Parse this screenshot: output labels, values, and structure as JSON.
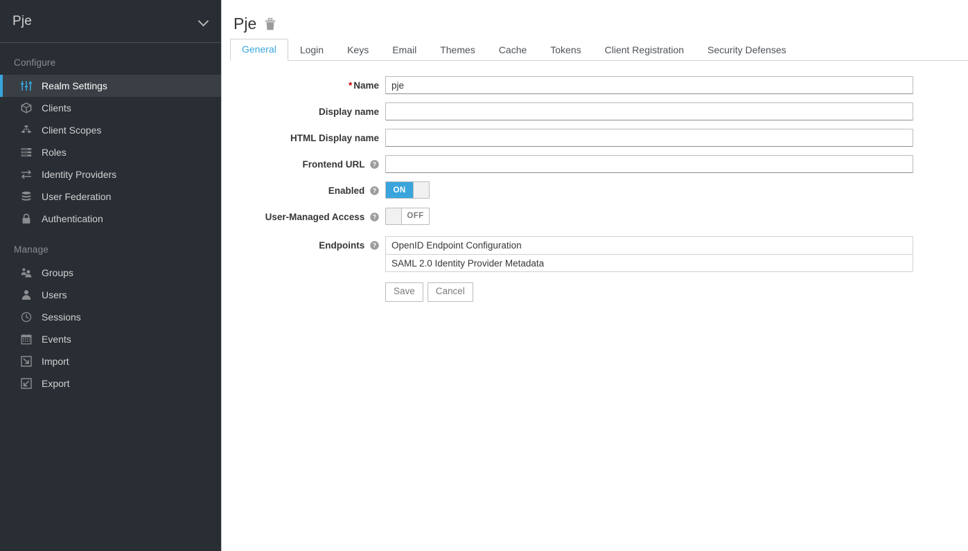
{
  "sidebar": {
    "realm": {
      "name": "Pje",
      "chevron_icon": "chevron-down-icon"
    },
    "groups": [
      {
        "title": "Configure",
        "items": [
          {
            "label": "Realm Settings",
            "icon": "sliders-icon",
            "active": true
          },
          {
            "label": "Clients",
            "icon": "cube-icon",
            "active": false
          },
          {
            "label": "Client Scopes",
            "icon": "cubes-icon",
            "active": false
          },
          {
            "label": "Roles",
            "icon": "list-icon",
            "active": false
          },
          {
            "label": "Identity Providers",
            "icon": "exchange-icon",
            "active": false
          },
          {
            "label": "User Federation",
            "icon": "database-icon",
            "active": false
          },
          {
            "label": "Authentication",
            "icon": "lock-icon",
            "active": false
          }
        ]
      },
      {
        "title": "Manage",
        "items": [
          {
            "label": "Groups",
            "icon": "users-group-icon",
            "active": false
          },
          {
            "label": "Users",
            "icon": "user-icon",
            "active": false
          },
          {
            "label": "Sessions",
            "icon": "clock-icon",
            "active": false
          },
          {
            "label": "Events",
            "icon": "calendar-icon",
            "active": false
          },
          {
            "label": "Import",
            "icon": "import-arrow-icon",
            "active": false
          },
          {
            "label": "Export",
            "icon": "export-arrow-icon",
            "active": false
          }
        ]
      }
    ]
  },
  "header": {
    "title": "Pje",
    "delete_icon": "trash-icon"
  },
  "tabs": [
    {
      "label": "General",
      "active": true
    },
    {
      "label": "Login",
      "active": false
    },
    {
      "label": "Keys",
      "active": false
    },
    {
      "label": "Email",
      "active": false
    },
    {
      "label": "Themes",
      "active": false
    },
    {
      "label": "Cache",
      "active": false
    },
    {
      "label": "Tokens",
      "active": false
    },
    {
      "label": "Client Registration",
      "active": false
    },
    {
      "label": "Security Defenses",
      "active": false
    }
  ],
  "form": {
    "name": {
      "label": "Name",
      "required": true,
      "value": "pje",
      "placeholder": ""
    },
    "display_name": {
      "label": "Display name",
      "value": "",
      "placeholder": ""
    },
    "html_display_name": {
      "label": "HTML Display name",
      "value": "",
      "placeholder": ""
    },
    "frontend_url": {
      "label": "Frontend URL",
      "value": "",
      "placeholder": "",
      "help_icon": "help-circle-icon"
    },
    "enabled": {
      "label": "Enabled",
      "state": "ON",
      "on": true,
      "help_icon": "help-circle-icon"
    },
    "user_managed_access": {
      "label": "User-Managed Access",
      "state": "OFF",
      "on": false,
      "help_icon": "help-circle-icon"
    },
    "endpoints": {
      "label": "Endpoints",
      "help_icon": "help-circle-icon",
      "items": [
        "OpenID Endpoint Configuration",
        "SAML 2.0 Identity Provider Metadata"
      ]
    },
    "save_label": "Save",
    "cancel_label": "Cancel"
  },
  "colors": {
    "accent": "#39a5dc",
    "sidebar_bg": "#292e34",
    "sidebar_active_bg": "#393f44",
    "required_red": "#cc0000",
    "text_dark": "#363636"
  }
}
